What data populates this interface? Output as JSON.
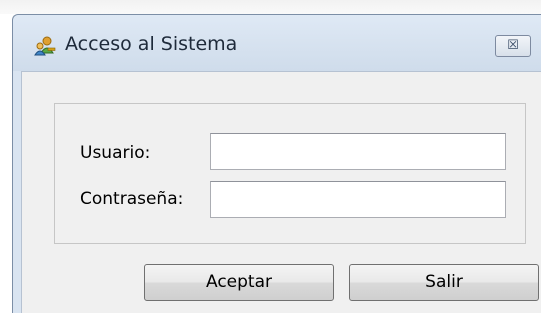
{
  "window": {
    "title": "Acceso al Sistema",
    "icon": "users-key-icon",
    "close_symbol": "☒"
  },
  "form": {
    "username_label": "Usuario:",
    "username_value": "",
    "password_label": "Contraseña:",
    "password_value": ""
  },
  "buttons": {
    "accept_label": "Aceptar",
    "exit_label": "Salir"
  },
  "colors": {
    "window_frame": "#d9e4f1",
    "client_background": "#f0f0f0"
  }
}
